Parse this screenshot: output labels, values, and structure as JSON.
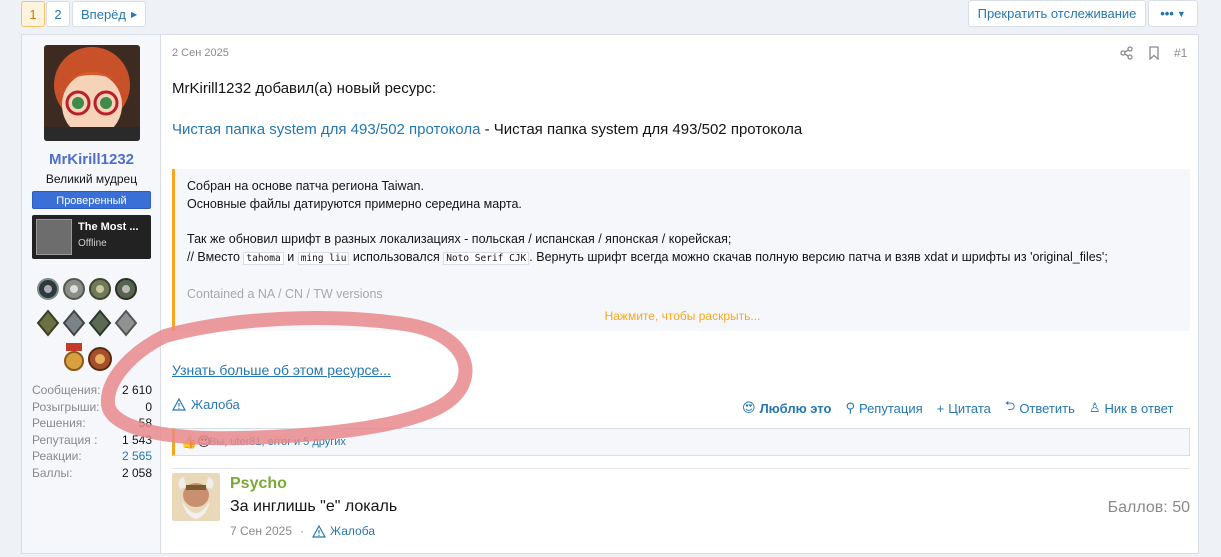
{
  "pagination": {
    "page1": "1",
    "page2": "2",
    "next": "Вперёд"
  },
  "header": {
    "stop_watching": "Прекратить отслеживание",
    "more": "•••"
  },
  "user": {
    "name": "MrKirill1232",
    "title": "Великий мудрец",
    "badge": "Проверенный",
    "status_title": "The Most ...",
    "status_sub": "Offline",
    "stats": [
      {
        "label": "Сообщения:",
        "value": "2 610"
      },
      {
        "label": "Розыгрыши:",
        "value": "0"
      },
      {
        "label": "Решения:",
        "value": "58"
      },
      {
        "label": "Репутация :",
        "value": "1 543"
      },
      {
        "label": "Реакции:",
        "value": "2 565"
      },
      {
        "label": "Баллы:",
        "value": "2 058"
      }
    ]
  },
  "post": {
    "date": "2 Сен 2025",
    "number": "#1",
    "intro": "MrKirill1232 добавил(а) новый ресурс:",
    "resource_link": "Чистая папка system для 493/502 протокола",
    "resource_sep": " - ",
    "resource_desc": "Чистая папка system для 493/502 протокола",
    "quote": {
      "line1": "Собран на основе патча региона Taiwan.",
      "line2": "Основные файлы датируются примерно середина марта.",
      "line3": "Так же обновил шрифт в разных локализациях - польская / испанская / японская / корейская;",
      "line4_a": "// Вместо ",
      "code1": "tahoma",
      "line4_b": " и ",
      "code2": "ming liu",
      "line4_c": " использовался ",
      "code3": "Noto Serif CJK",
      "line4_d": ". Вернуть шрифт всегда можно скачав полную версию патча и взяв xdat и шрифты из 'original_files';",
      "line5": "Contained a NA / CN / TW versions",
      "expand": "Нажмите, чтобы раскрыть..."
    },
    "more_link": "Узнать больше об этом ресурсе...",
    "report": "Жалоба",
    "actions": {
      "love": "Люблю это",
      "reputation": "Репутация",
      "quote": "Цитата",
      "reply": "Ответить",
      "nick": "Ник в ответ"
    },
    "reactions_text": "Вы, uter81, error и 5 других"
  },
  "reply": {
    "name": "Psycho",
    "text": "За инглишь \"е\" локаль",
    "date": "7 Сен 2025",
    "sep": "·",
    "report": "Жалоба",
    "points": "Баллов: 50"
  },
  "colors": {
    "accent": "#2577b1",
    "highlight": "#f6a71c",
    "annotation": "#e8898c"
  }
}
